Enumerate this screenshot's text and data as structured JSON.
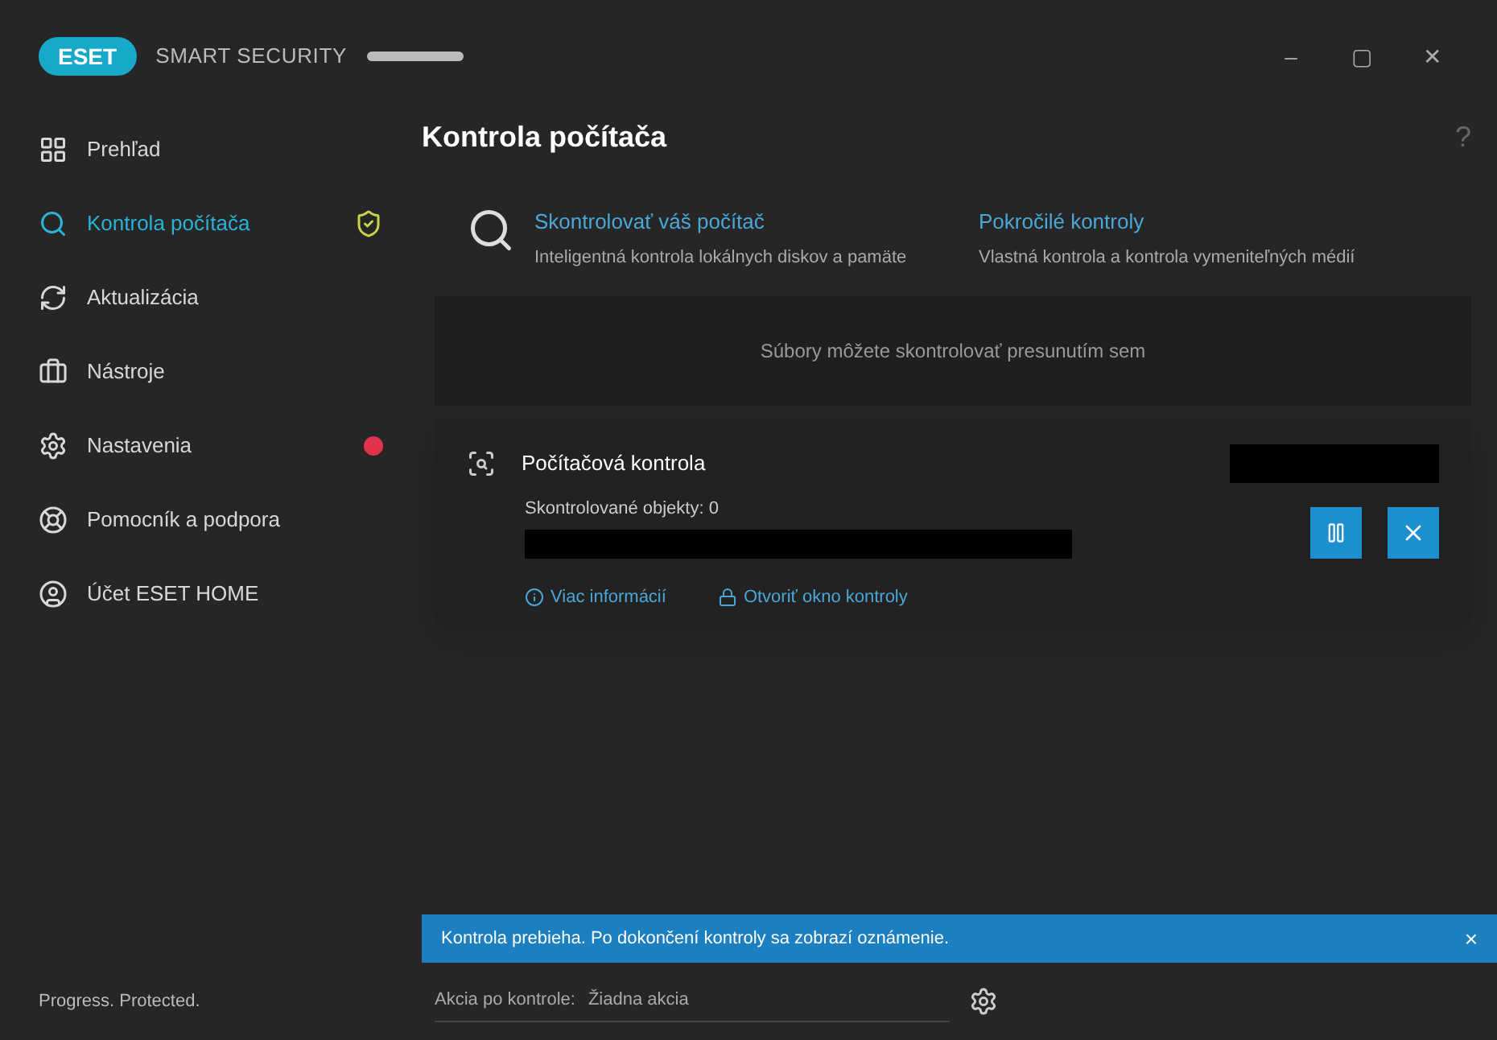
{
  "window": {
    "logo": "ESET",
    "title": "SMART SECURITY",
    "controls": [
      "–",
      "▢",
      "✕"
    ]
  },
  "sidebar": {
    "items": [
      {
        "label": "Prehľad",
        "kind": "plain",
        "selected": false
      },
      {
        "label": "Kontrola počítača",
        "kind": "protected",
        "selected": true
      },
      {
        "label": "Aktualizácia",
        "kind": "plain",
        "selected": false
      },
      {
        "label": "Nástroje",
        "kind": "plain",
        "selected": false
      },
      {
        "label": "Nastavenia",
        "kind": "alert",
        "selected": false
      },
      {
        "label": "Pomocník a podpora",
        "kind": "plain",
        "selected": false
      },
      {
        "label": "Účet ESET HOME",
        "kind": "plain",
        "selected": false
      }
    ],
    "footer": "Progress. Protected."
  },
  "page": {
    "title": "Kontrola počítača",
    "help": "?",
    "actions": [
      {
        "title": "Skontrolovať váš počítač",
        "description": "Inteligentná kontrola lokálnych diskov a pamäte"
      },
      {
        "title": "Pokročilé kontroly",
        "description": "Vlastná kontrola a kontrola vymeniteľných médií"
      }
    ],
    "drop_zone": "Súbory môžete skontrolovať presunutím sem",
    "scan": {
      "title": "Počítačová kontrola",
      "progress_label": "Skontrolované objekty: 0",
      "links": [
        "Viac informácií",
        "Otvoriť okno kontroly"
      ]
    },
    "banner": {
      "text": "Kontrola prebieha. Po dokončení kontroly sa zobrazí oznámenie.",
      "close": "×"
    },
    "after_scan": {
      "label": "Akcia po kontrole:",
      "value": "Žiadna akcia"
    }
  }
}
